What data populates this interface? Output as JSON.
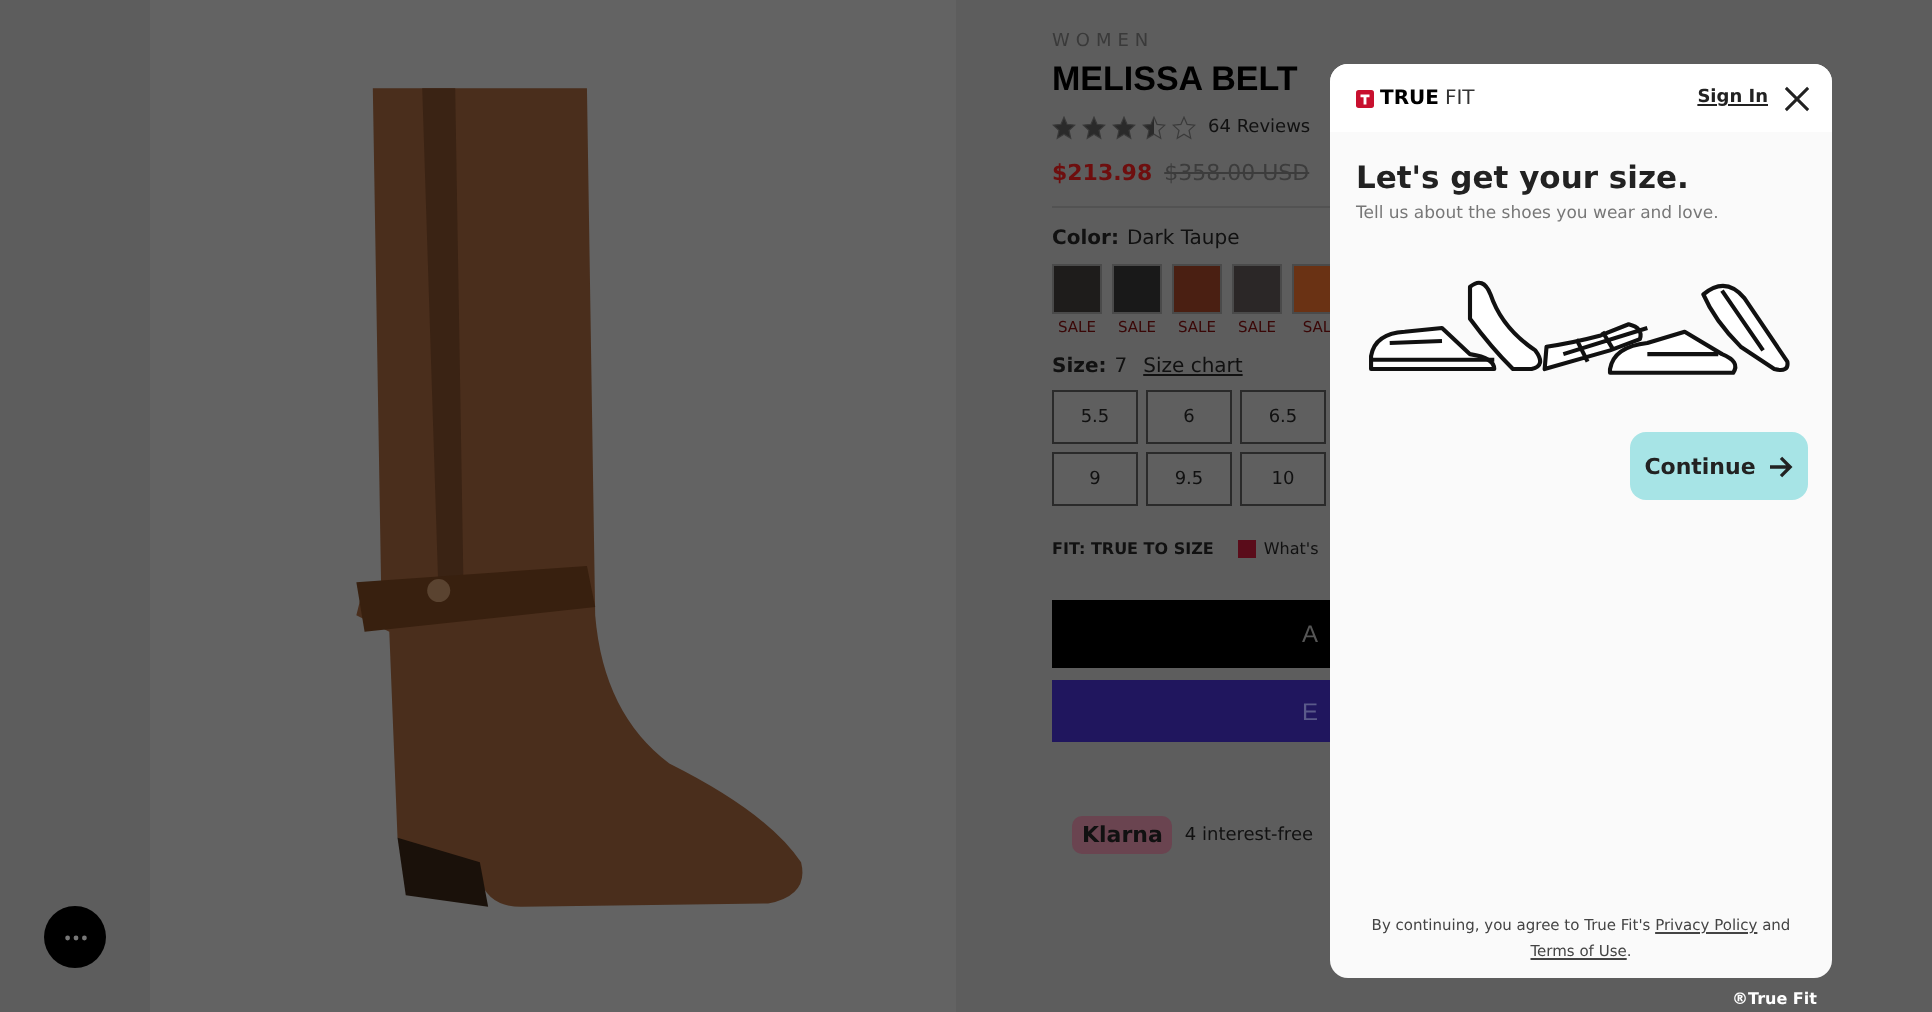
{
  "product": {
    "category": "WOMEN",
    "title": "MELISSA BELT",
    "stars": 3.5,
    "reviews": "64 Reviews",
    "price": "$213.98",
    "original_price": "$358.00 USD",
    "color_label": "Color:",
    "color_value": "Dark Taupe",
    "swatches": [
      {
        "color": "#1e1c1b",
        "badge": "SALE"
      },
      {
        "color": "#191919",
        "badge": "SALE"
      },
      {
        "color": "#4a1f12",
        "badge": "SALE"
      },
      {
        "color": "#2b2727",
        "badge": "SALE"
      },
      {
        "color": "#6a3214",
        "badge": "SAL"
      }
    ],
    "size_label": "Size:",
    "size_value": "7",
    "size_chart": "Size chart",
    "sizes": [
      "5.5",
      "6",
      "6.5",
      "9",
      "9.5",
      "10"
    ],
    "fit_label": "FIT: TRUE TO SIZE",
    "fit_link": "What's",
    "add_button": "A",
    "buy_button": "E",
    "klarna": "Klarna",
    "klarna_text": "4 interest-free"
  },
  "modal": {
    "brand_bold": "TRUE",
    "brand_light": "FIT",
    "sign_in": "Sign In",
    "heading": "Let's get your size.",
    "subheading": "Tell us about the shoes you wear and love.",
    "continue": "Continue",
    "legal_before": "By continuing, you agree to True Fit's",
    "privacy": "Privacy Policy",
    "legal_and": "and",
    "terms": "Terms of Use",
    "legal_end": "."
  },
  "watermark_credit": "®True Fit"
}
